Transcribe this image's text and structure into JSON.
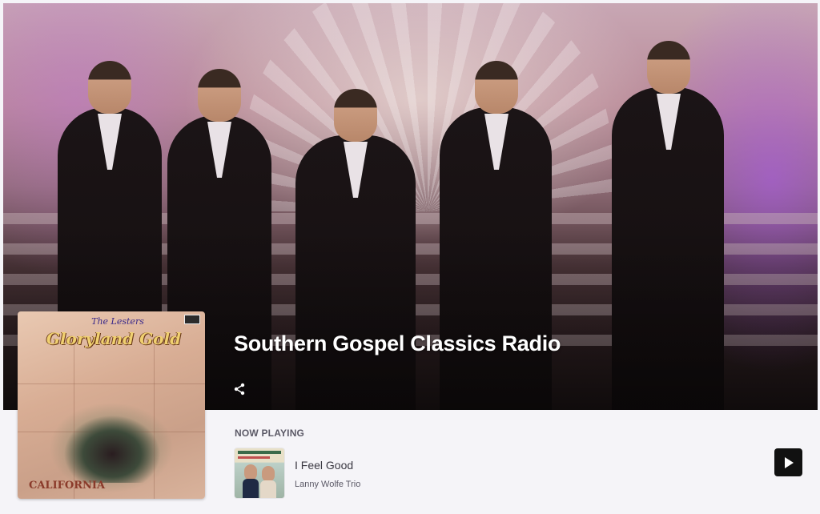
{
  "station": {
    "title": "Southern Gospel Classics Radio",
    "share_icon": "share-icon"
  },
  "album_art": {
    "subtitle": "The Lesters",
    "title": "Gloryland Gold",
    "footer": "CALIFORNIA"
  },
  "now_playing": {
    "label": "NOW PLAYING",
    "track_title": "I Feel Good",
    "artist": "Lanny Wolfe Trio",
    "play_icon": "play-icon"
  },
  "colors": {
    "page_background": "#f5f4f8",
    "title_text": "#ffffff",
    "play_button": "#111111",
    "label_text": "#5b5966"
  }
}
